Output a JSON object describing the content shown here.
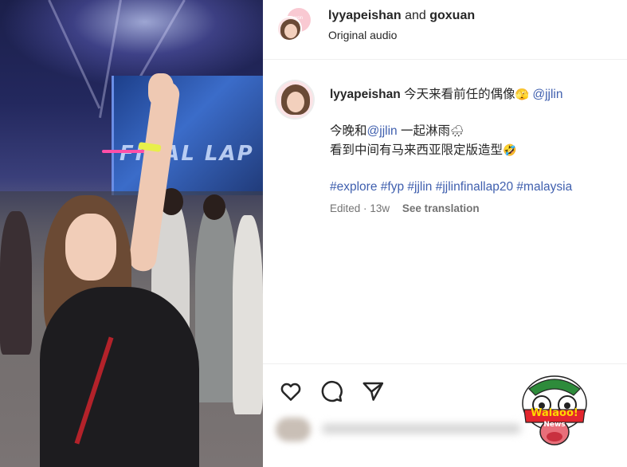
{
  "header": {
    "user1": "lyyapeishan",
    "conjunction": "and",
    "user2": "goxuan",
    "audio": "Original audio",
    "avatar_back_text": "won"
  },
  "caption": {
    "username": "lyyapeishan",
    "line1_text": "今天来看前任的偶像",
    "line1_emoji": "🫣",
    "line1_mention": "@jjlin",
    "line2_prefix": "今晚和",
    "line2_mention": "@jjlin",
    "line2_suffix": "一起淋雨",
    "line2_emoji": "🌧",
    "line3_text": "看到中间有马来西亚限定版造型",
    "line3_emoji": "🤣",
    "hashtags": [
      "#explore",
      "#fyp",
      "#jjlin",
      "#jjlinfinallap20",
      "#malaysia"
    ]
  },
  "meta": {
    "edited": "Edited",
    "separator": "·",
    "age": "13w",
    "see_translation": "See translation"
  },
  "actions": [
    {
      "icon": "heart-icon"
    },
    {
      "icon": "comment-icon"
    },
    {
      "icon": "share-icon"
    }
  ],
  "photo": {
    "screen_text": "FINAL LAP"
  },
  "watermark": {
    "line1": "Walaoo!",
    "line2": "News"
  },
  "colors": {
    "link": "#3f5fae",
    "text": "#262626",
    "muted": "#737373"
  }
}
